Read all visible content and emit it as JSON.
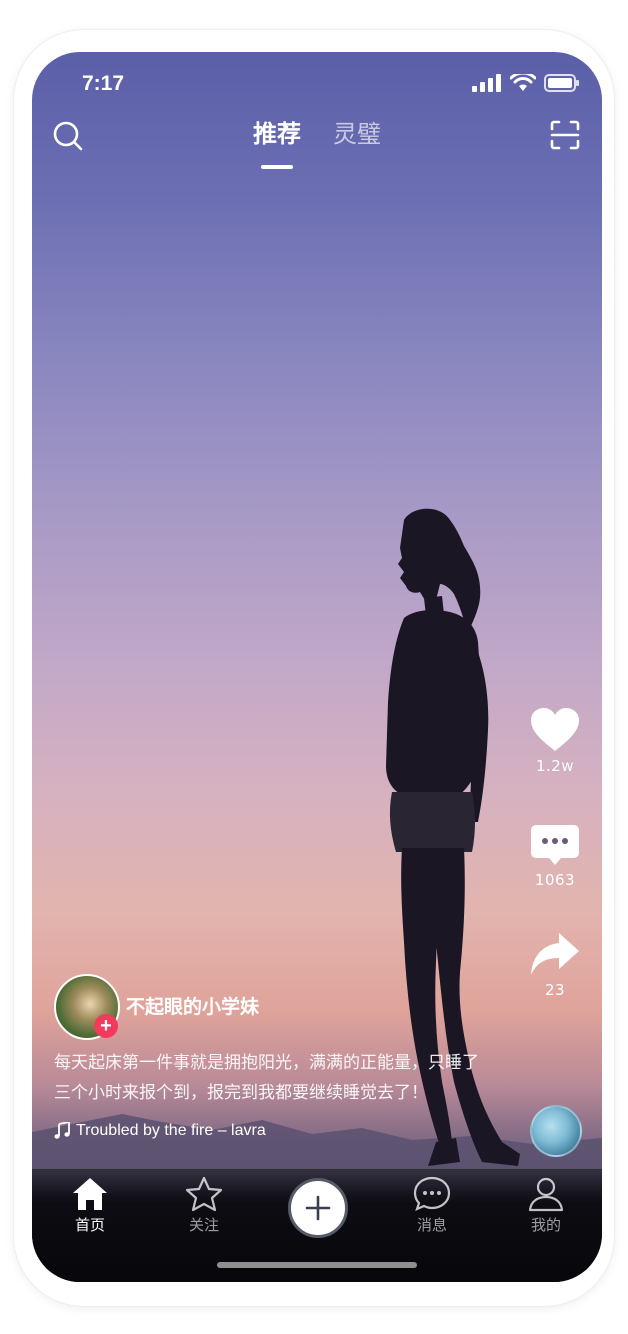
{
  "status_bar": {
    "time": "7:17",
    "icons": [
      "signal-icon",
      "wifi-icon",
      "battery-icon"
    ]
  },
  "top_nav": {
    "search_icon": "search-icon",
    "scan_icon": "scan-icon",
    "tabs": [
      {
        "label": "推荐",
        "active": true
      },
      {
        "label": "灵璧",
        "active": false
      }
    ]
  },
  "actions": {
    "like_count": "1.2w",
    "comment_count": "1063",
    "share_count": "23"
  },
  "post": {
    "username": "不起眼的小学妹",
    "caption_line1": "每天起床第一件事就是拥抱阳光，满满的正能量，只睡了",
    "caption_line2": "三个小时来报个到，报完到我都要继续睡觉去了！",
    "music": "Troubled by the fire – lavra",
    "follow_symbol": "+"
  },
  "bottom_nav": {
    "items": [
      {
        "label": "首页",
        "icon": "home-icon",
        "active": true
      },
      {
        "label": "关注",
        "icon": "star-icon",
        "active": false
      },
      {
        "label": "消息",
        "icon": "message-icon",
        "active": false
      },
      {
        "label": "我的",
        "icon": "user-icon",
        "active": false
      }
    ]
  },
  "colors": {
    "accent": "#f23a5e",
    "text": "#ffffff"
  }
}
